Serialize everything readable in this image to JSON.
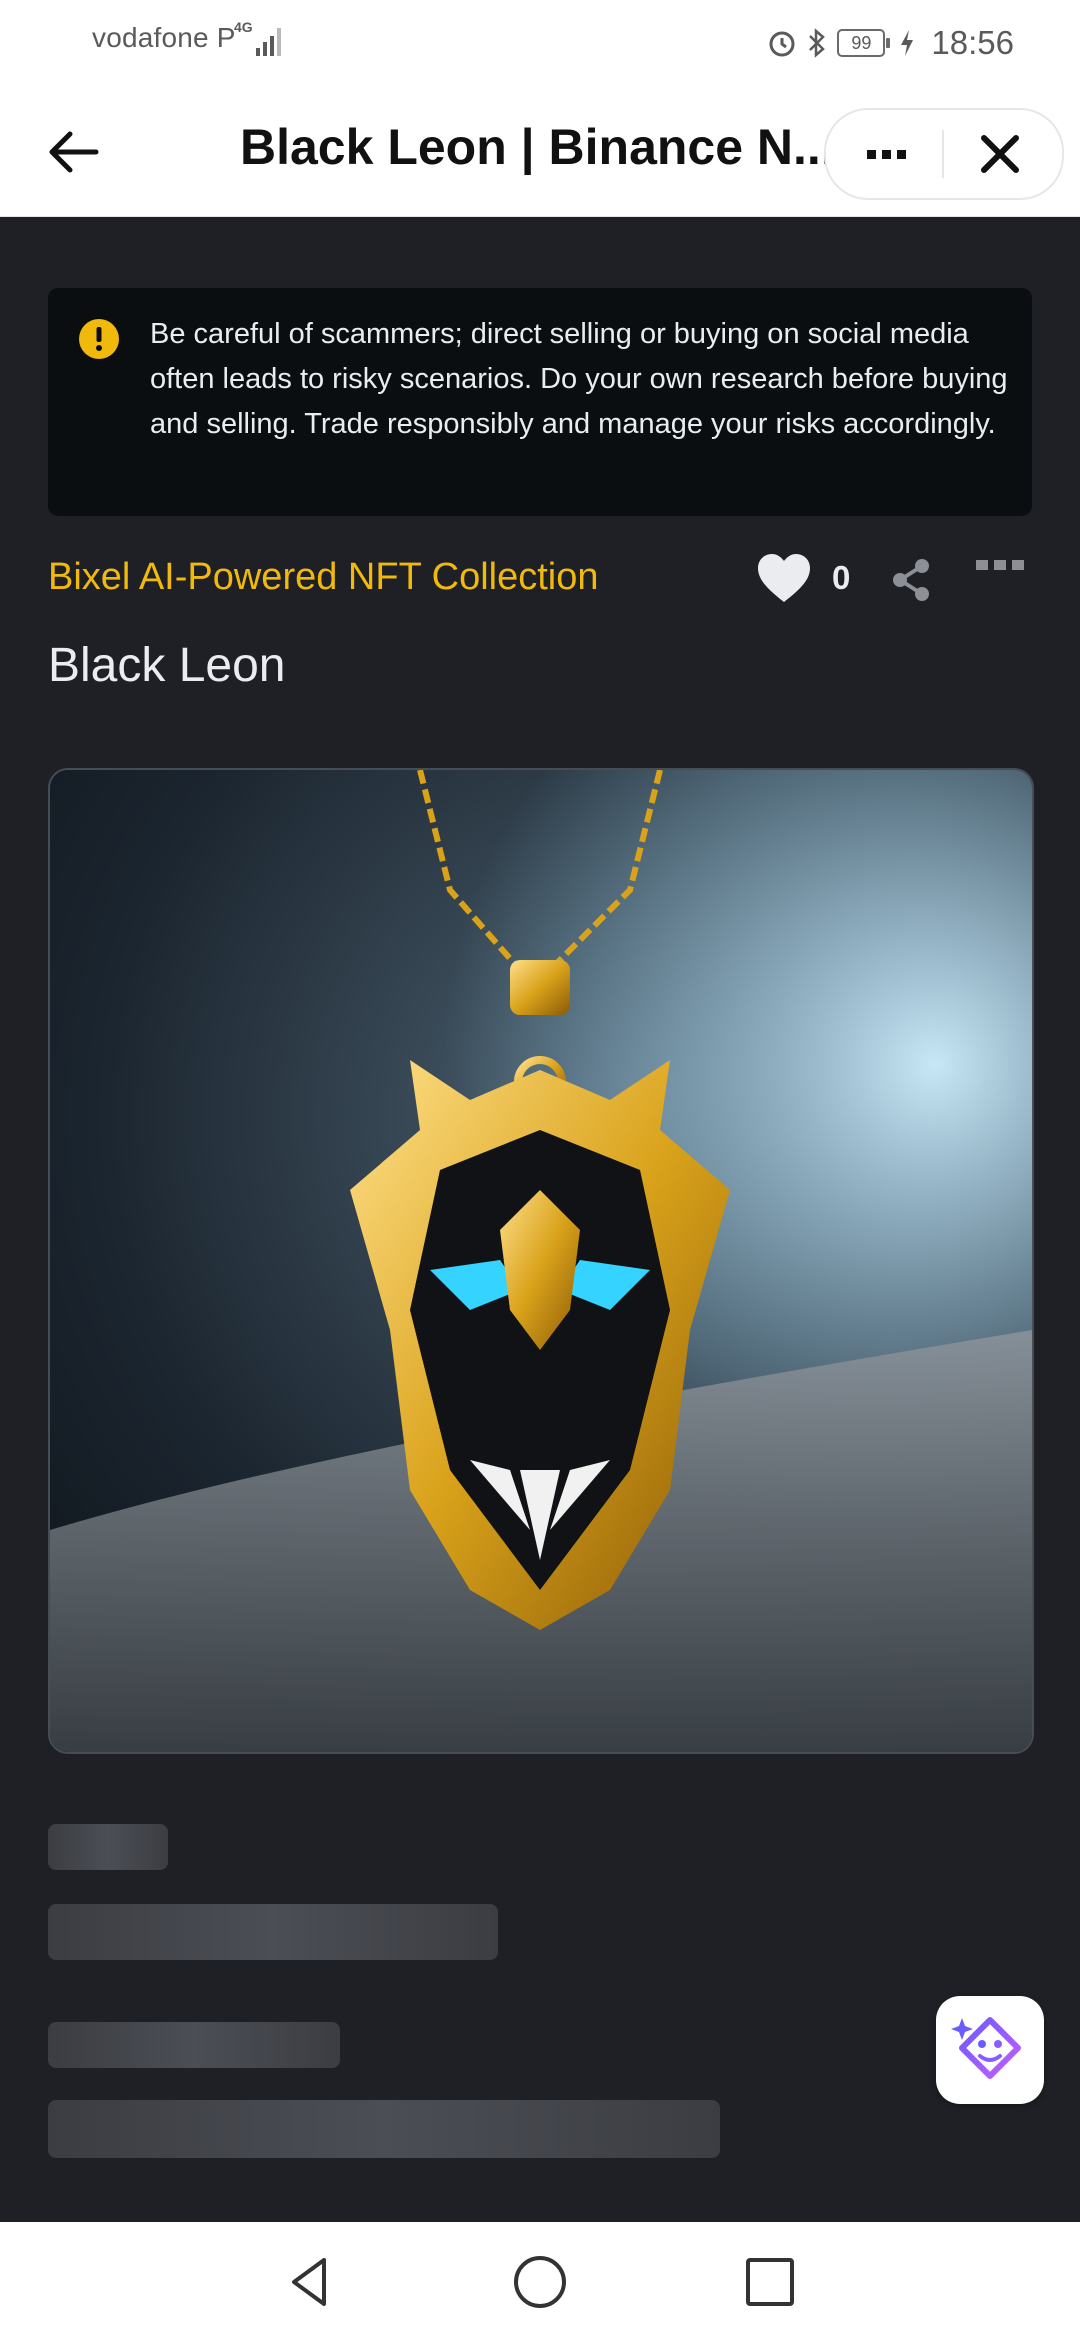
{
  "status_bar": {
    "carrier": "vodafone P",
    "network": "4G",
    "battery": "99",
    "time": "18:56"
  },
  "app_bar": {
    "title": "Black Leon | Binance N..."
  },
  "warning": {
    "text": "Be careful of scammers; direct selling or buying on social media often leads to risky scenarios. Do your own research before buying and selling. Trade responsibly and manage your risks accordingly."
  },
  "nft": {
    "collection": "Bixel AI-Powered NFT Collection",
    "name": "Black Leon",
    "like_count": "0"
  },
  "colors": {
    "accent": "#f0b90b",
    "page_bg": "#1e2026",
    "warning_bg": "#0b0e11"
  },
  "icons": [
    "back-arrow-icon",
    "more-icon",
    "close-icon",
    "alert-icon",
    "heart-icon",
    "share-icon",
    "assistant-icon",
    "nav-back-icon",
    "nav-home-icon",
    "nav-recents-icon"
  ]
}
